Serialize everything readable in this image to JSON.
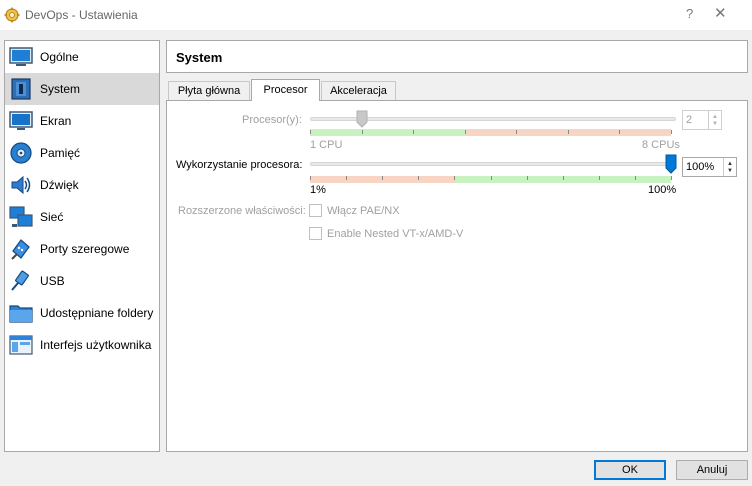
{
  "window": {
    "title": "DevOps - Ustawienia",
    "help_label": "?",
    "close_label": "✕"
  },
  "sidebar": {
    "items": [
      {
        "label": "Ogólne",
        "icon": "general-icon"
      },
      {
        "label": "System",
        "icon": "system-icon",
        "selected": true
      },
      {
        "label": "Ekran",
        "icon": "display-icon"
      },
      {
        "label": "Pamięć",
        "icon": "storage-icon"
      },
      {
        "label": "Dźwięk",
        "icon": "audio-icon"
      },
      {
        "label": "Sieć",
        "icon": "network-icon"
      },
      {
        "label": "Porty szeregowe",
        "icon": "serial-ports-icon"
      },
      {
        "label": "USB",
        "icon": "usb-icon"
      },
      {
        "label": "Udostępniane foldery",
        "icon": "shared-folders-icon"
      },
      {
        "label": "Interfejs użytkownika",
        "icon": "user-interface-icon"
      }
    ]
  },
  "header": {
    "title": "System"
  },
  "tabs": [
    {
      "label": "Płyta główna"
    },
    {
      "label": "Procesor",
      "active": true
    },
    {
      "label": "Akceleracja"
    }
  ],
  "processor": {
    "cpu_label": "Procesor(y):",
    "cpu_value": "2",
    "cpu_min_label": "1 CPU",
    "cpu_max_label": "8 CPUs",
    "cpu_fraction": 0.143,
    "cap_label": "Wykorzystanie procesora:",
    "cap_value": "100%",
    "cap_min_label": "1%",
    "cap_max_label": "100%",
    "cap_fraction": 1.0,
    "ext_label": "Rozszerzone właściwości:",
    "pae_label": "Włącz PAE/NX",
    "nested_label": "Enable Nested VT-x/AMD-V",
    "pae_checked": false,
    "nested_checked": false
  },
  "colors": {
    "green_band": "#c9f2c1",
    "red_band": "#f8d4c4",
    "accent": "#0078d7"
  },
  "buttons": {
    "ok": "OK",
    "cancel": "Anuluj"
  }
}
